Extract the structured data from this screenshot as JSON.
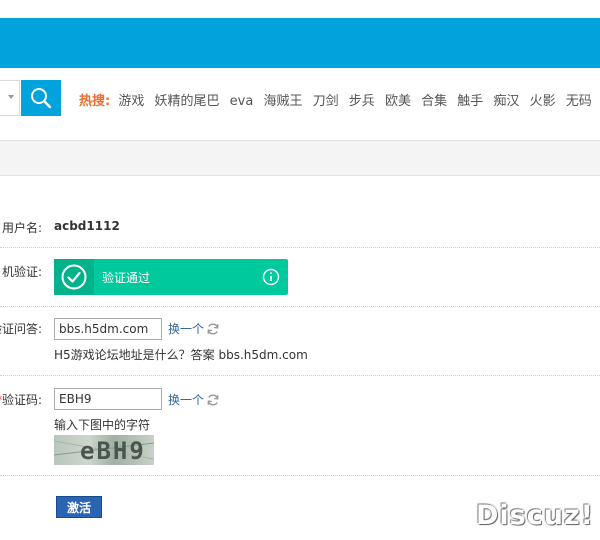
{
  "header": {
    "accent_color": "#00a3db"
  },
  "search": {
    "hot_label": "热搜:",
    "hot_keywords": [
      "游戏",
      "妖精的尾巴",
      "eva",
      "海贼王",
      "刀剑",
      "步兵",
      "欧美",
      "合集",
      "触手",
      "痴汉",
      "火影",
      "无码"
    ]
  },
  "form": {
    "username_label": "用户名:",
    "username_value": "acbd1112",
    "captcha_label": "机验证:",
    "captcha_status": "验证通过",
    "captcha_color": "#00c99e",
    "question_label": "验证问答:",
    "question_value": "bbs.h5dm.com",
    "change_label": "换一个",
    "question_hint": "H5游戏论坛地址是什么？答案 bbs.h5dm.com",
    "seccode_req": "*",
    "seccode_label": "验证码:",
    "seccode_value": "EBH9",
    "seccode_hint": "输入下图中的字符",
    "seccode_image_text": "eBH9",
    "activate_label": "激活"
  },
  "watermark": "Discuz!"
}
